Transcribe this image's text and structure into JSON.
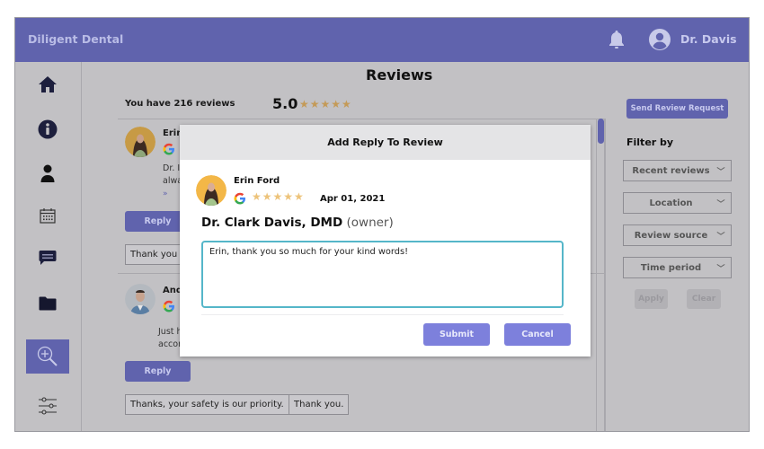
{
  "header": {
    "brand": "Diligent Dental",
    "user_name": "Dr. Davis",
    "icons": {
      "notifications": "bell-icon",
      "user": "user-circle-icon"
    }
  },
  "sidebar": {
    "items": [
      {
        "name": "home",
        "icon": "home-icon",
        "active": false
      },
      {
        "name": "info",
        "icon": "info-icon",
        "active": false
      },
      {
        "name": "patients",
        "icon": "person-icon",
        "active": false
      },
      {
        "name": "calendar",
        "icon": "calendar-icon",
        "active": false
      },
      {
        "name": "messages",
        "icon": "chat-icon",
        "active": false
      },
      {
        "name": "files",
        "icon": "folder-icon",
        "active": false
      },
      {
        "name": "reviews",
        "icon": "zoom-in-icon",
        "active": true
      },
      {
        "name": "settings",
        "icon": "sliders-icon",
        "active": false
      }
    ]
  },
  "main": {
    "title": "Reviews",
    "summary": "You have 216 reviews",
    "average_rating": "5.0",
    "average_stars": 5,
    "stars_glyph": "★★★★★",
    "reviews": [
      {
        "name_visible": "Erin",
        "source": "google",
        "text_lines": [
          "Dr. I",
          "alwa"
        ],
        "more": "»",
        "reply_label": "Reply",
        "quick_replies": [
          "Thank you s"
        ]
      },
      {
        "name_visible": "And",
        "source": "google",
        "text_lines": [
          "Just h",
          "accor"
        ],
        "reply_label": "Reply",
        "quick_replies": [
          "Thanks, your safety is our priority.",
          "Thank you."
        ]
      }
    ]
  },
  "right_panel": {
    "send_request_label": "Send Review Request",
    "filter_title": "Filter by",
    "filters": [
      {
        "label": "Recent reviews"
      },
      {
        "label": "Location"
      },
      {
        "label": "Review source"
      },
      {
        "label": "Time period"
      }
    ],
    "chevron": "﹀",
    "apply_label": "Apply",
    "clear_label": "Clear"
  },
  "modal": {
    "title": "Add Reply To Review",
    "reviewer_name": "Erin Ford",
    "reviewer_stars": 5,
    "stars_glyph": "★★★★★",
    "review_date": "Apr 01, 2021",
    "owner_name": "Dr. Clark Davis, DMD",
    "owner_tag": "(owner)",
    "reply_text": "Erin, thank you so much for your kind words!",
    "submit_label": "Submit",
    "cancel_label": "Cancel"
  },
  "colors": {
    "brand": "#6063ad",
    "modal_button": "#7d80dc",
    "star": "#edc37a",
    "textarea_focus": "#55b6c9"
  }
}
